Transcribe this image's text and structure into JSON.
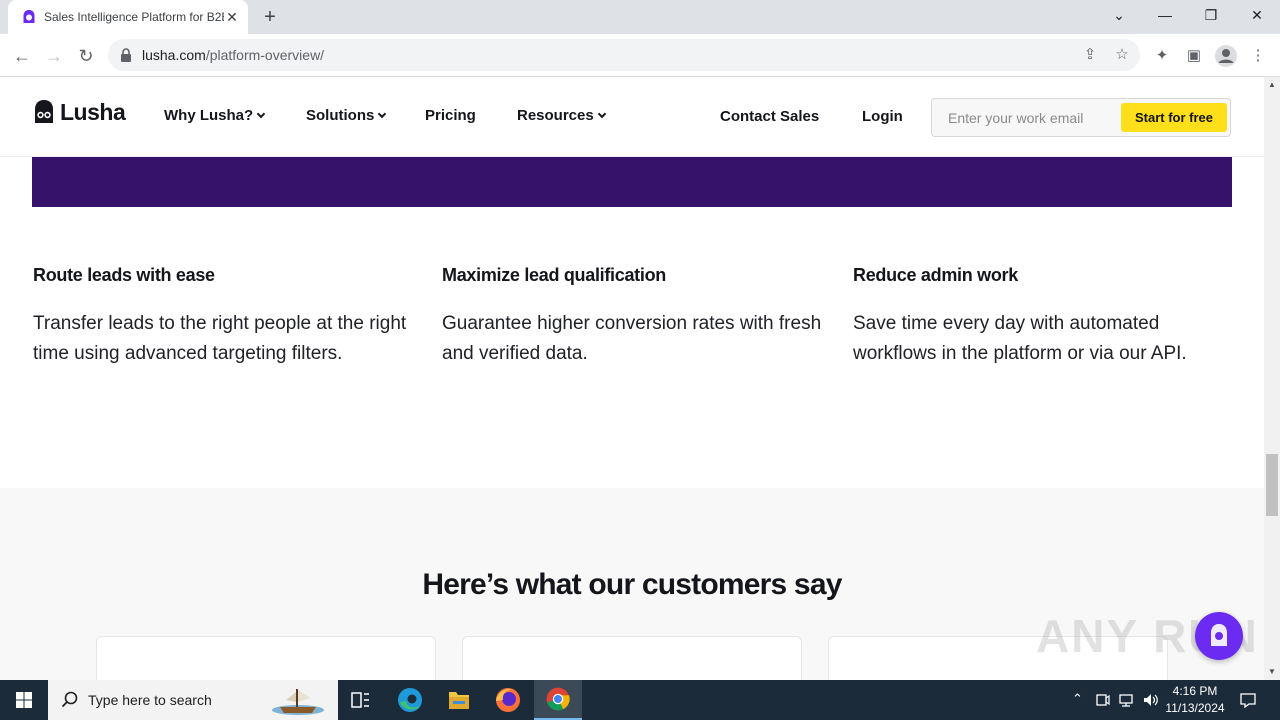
{
  "browser": {
    "tab_title": "Sales Intelligence Platform for B2B",
    "tab_close": "✕",
    "new_tab": "+",
    "url_domain": "lusha.com",
    "url_path": "/platform-overview/",
    "controls": {
      "dropdown": "⌄",
      "minimize": "—",
      "restore": "❐",
      "close": "✕"
    }
  },
  "site_nav": {
    "brand": "Lusha",
    "items": [
      {
        "label": "Why Lusha?",
        "has_dropdown": true
      },
      {
        "label": "Solutions",
        "has_dropdown": true
      },
      {
        "label": "Pricing",
        "has_dropdown": false
      },
      {
        "label": "Resources",
        "has_dropdown": true
      }
    ],
    "contact_sales": "Contact Sales",
    "login": "Login",
    "email_placeholder": "Enter your work email",
    "cta": "Start for free"
  },
  "features": [
    {
      "title": "Route leads with ease",
      "body": "Transfer leads to the right people at the right time using advanced targeting filters."
    },
    {
      "title": "Maximize lead qualification",
      "body": "Guarantee higher conversion rates with fresh and verified data."
    },
    {
      "title": "Reduce admin work",
      "body": "Save time every day with automated workflows in the platform or via our API."
    }
  ],
  "testimonials": {
    "heading": "Here’s what our customers say"
  },
  "watermark": "ANY RUN",
  "taskbar": {
    "search_placeholder": "Type here to search",
    "time": "4:16 PM",
    "date": "11/13/2024"
  },
  "colors": {
    "brand_purple": "#36126b",
    "cta_yellow": "#ffde1a",
    "chat_purple": "#6b2bf0",
    "taskbar": "#1c2b3a"
  }
}
